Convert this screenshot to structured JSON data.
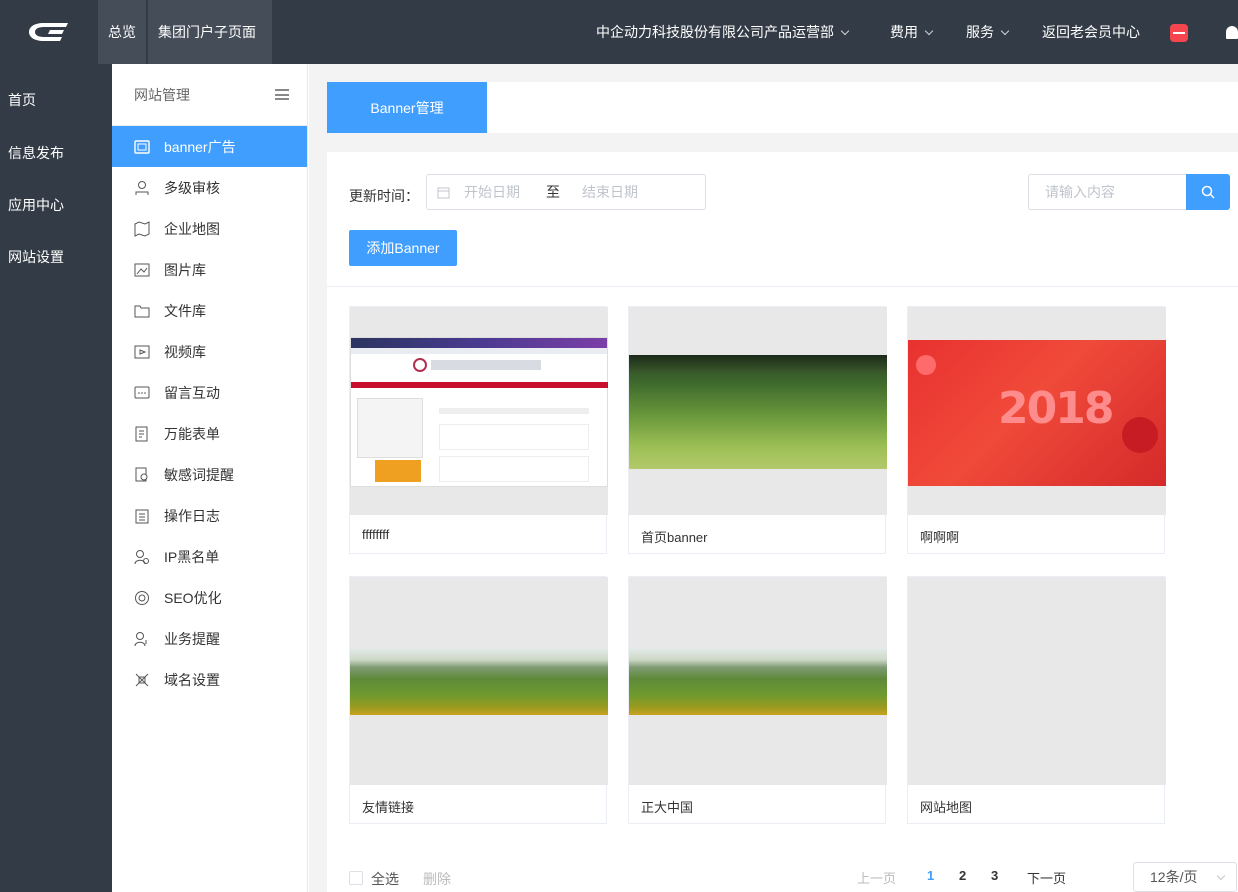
{
  "topbar": {
    "logo_text": "CE",
    "nav_overview": "总览",
    "nav_group_portal": "集团门户子页面",
    "org_name": "中企动力科技股份有限公司产品运营部",
    "fees": "费用",
    "service": "服务",
    "back_center": "返回老会员中心"
  },
  "leftnav": [
    "首页",
    "信息发布",
    "应用中心",
    "网站设置"
  ],
  "sidebar": {
    "title": "网站管理",
    "items": [
      "banner广告",
      "多级审核",
      "企业地图",
      "图片库",
      "文件库",
      "视频库",
      "留言互动",
      "万能表单",
      "敏感词提醒",
      "操作日志",
      "IP黑名单",
      "SEO优化",
      "业务提醒",
      "域名设置"
    ]
  },
  "tabs": {
    "active": "Banner管理"
  },
  "filter": {
    "label": "更新时间：",
    "start_placeholder": "开始日期",
    "to": "至",
    "end_placeholder": "结束日期",
    "search_placeholder": "请输入内容",
    "add_button": "添加Banner"
  },
  "cards": [
    {
      "title": "ffffffff",
      "thumb": "webpage-screenshot"
    },
    {
      "title": "首页banner",
      "thumb": "wheat-field"
    },
    {
      "title": "啊啊啊",
      "thumb": "red-2018"
    },
    {
      "title": "友情链接",
      "thumb": "landscape-strip"
    },
    {
      "title": "正大中国",
      "thumb": "landscape-strip"
    },
    {
      "title": "网站地图",
      "thumb": "empty"
    }
  ],
  "thumb_text": {
    "year": "2018"
  },
  "footer": {
    "select_all": "全选",
    "delete": "删除",
    "prev": "上一页",
    "pages": [
      "1",
      "2",
      "3"
    ],
    "next": "下一页",
    "page_size": "12条/页"
  },
  "colors": {
    "accent": "#409eff",
    "nav_bg": "#333c46",
    "badge": "#f5454f"
  }
}
